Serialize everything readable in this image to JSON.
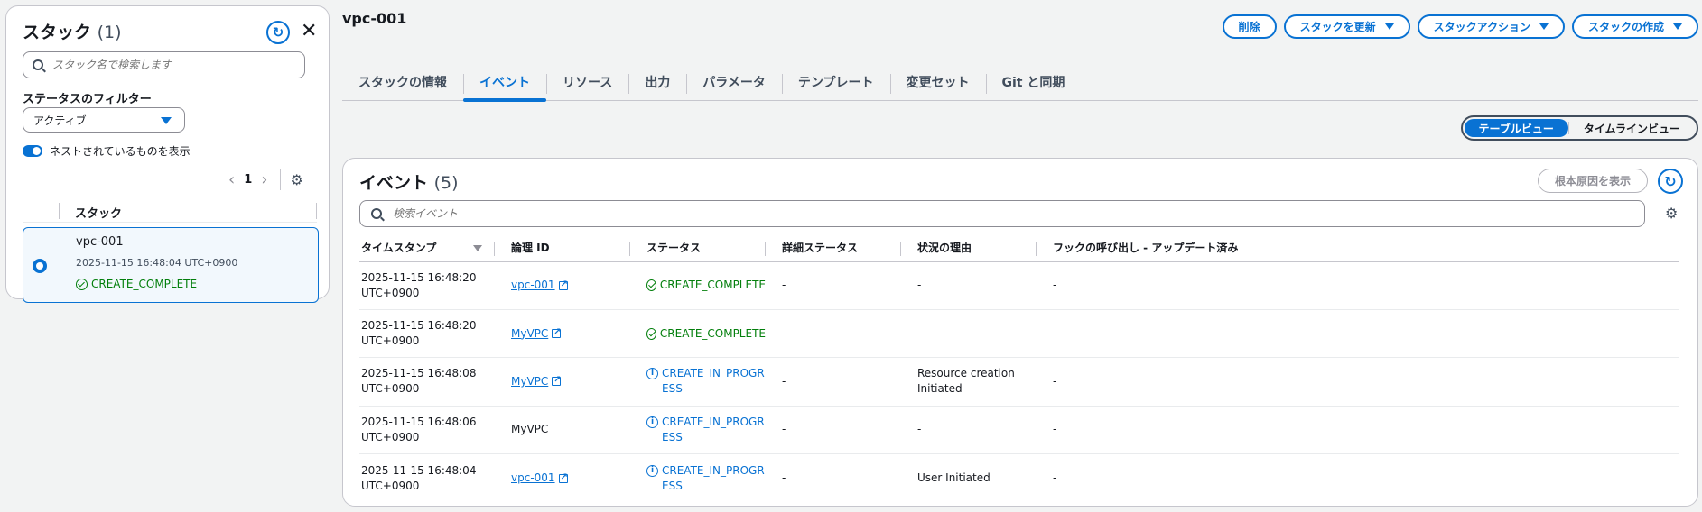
{
  "left_panel": {
    "title": "スタック",
    "count": "(1)",
    "search_placeholder": "スタック名で検索します",
    "filter_label": "ステータスのフィルター",
    "filter_value": "アクティブ",
    "nested_toggle_label": "ネストされているものを表示",
    "nested_toggle_on": true,
    "page_number": "1",
    "column_header": "スタック",
    "stack": {
      "name": "vpc-001",
      "created": "2025-11-15 16:48:04 UTC+0900",
      "status": "CREATE_COMPLETE",
      "selected": true
    }
  },
  "main": {
    "title": "vpc-001",
    "actions": {
      "delete": "削除",
      "update": "スタックを更新",
      "stack_actions": "スタックアクション",
      "create": "スタックの作成"
    },
    "tabs": [
      {
        "label": "スタックの情報",
        "active": false
      },
      {
        "label": "イベント",
        "active": true
      },
      {
        "label": "リソース",
        "active": false
      },
      {
        "label": "出力",
        "active": false
      },
      {
        "label": "パラメータ",
        "active": false
      },
      {
        "label": "テンプレート",
        "active": false
      },
      {
        "label": "変更セット",
        "active": false
      },
      {
        "label": "Git と同期",
        "active": false
      }
    ],
    "view_toggle": {
      "table": "テーブルビュー",
      "timeline": "タイムラインビュー",
      "selected": "table"
    }
  },
  "events": {
    "title": "イベント",
    "count": "(5)",
    "root_cause_button": "根本原因を表示",
    "search_placeholder": "検索イベント",
    "columns": [
      "タイムスタンプ",
      "論理 ID",
      "ステータス",
      "詳細ステータス",
      "状況の理由",
      "フックの呼び出し - アップデート済み"
    ],
    "rows": [
      {
        "timestamp_line1": "2025-11-15 16:48:20",
        "timestamp_line2": "UTC+0900",
        "logical_id": "vpc-001",
        "logical_id_link": true,
        "status": "CREATE_COMPLETE",
        "status_type": "success",
        "detailed_status": "-",
        "reason": "-",
        "hooks": "-"
      },
      {
        "timestamp_line1": "2025-11-15 16:48:20",
        "timestamp_line2": "UTC+0900",
        "logical_id": "MyVPC",
        "logical_id_link": true,
        "status": "CREATE_COMPLETE",
        "status_type": "success",
        "detailed_status": "-",
        "reason": "-",
        "hooks": "-"
      },
      {
        "timestamp_line1": "2025-11-15 16:48:08",
        "timestamp_line2": "UTC+0900",
        "logical_id": "MyVPC",
        "logical_id_link": true,
        "status": "CREATE_IN_PROGRESS",
        "status_type": "info",
        "detailed_status": "-",
        "reason": "Resource creation Initiated",
        "hooks": "-"
      },
      {
        "timestamp_line1": "2025-11-15 16:48:06",
        "timestamp_line2": "UTC+0900",
        "logical_id": "MyVPC",
        "logical_id_link": false,
        "status": "CREATE_IN_PROGRESS",
        "status_type": "info",
        "detailed_status": "-",
        "reason": "-",
        "hooks": "-"
      },
      {
        "timestamp_line1": "2025-11-15 16:48:04",
        "timestamp_line2": "UTC+0900",
        "logical_id": "vpc-001",
        "logical_id_link": true,
        "status": "CREATE_IN_PROGRESS",
        "status_type": "info",
        "detailed_status": "-",
        "reason": "User Initiated",
        "hooks": "-"
      }
    ]
  },
  "colors": {
    "accent": "#0972d3",
    "success": "#037f0c",
    "text": "#16191f",
    "background": "#f2f3f3"
  }
}
